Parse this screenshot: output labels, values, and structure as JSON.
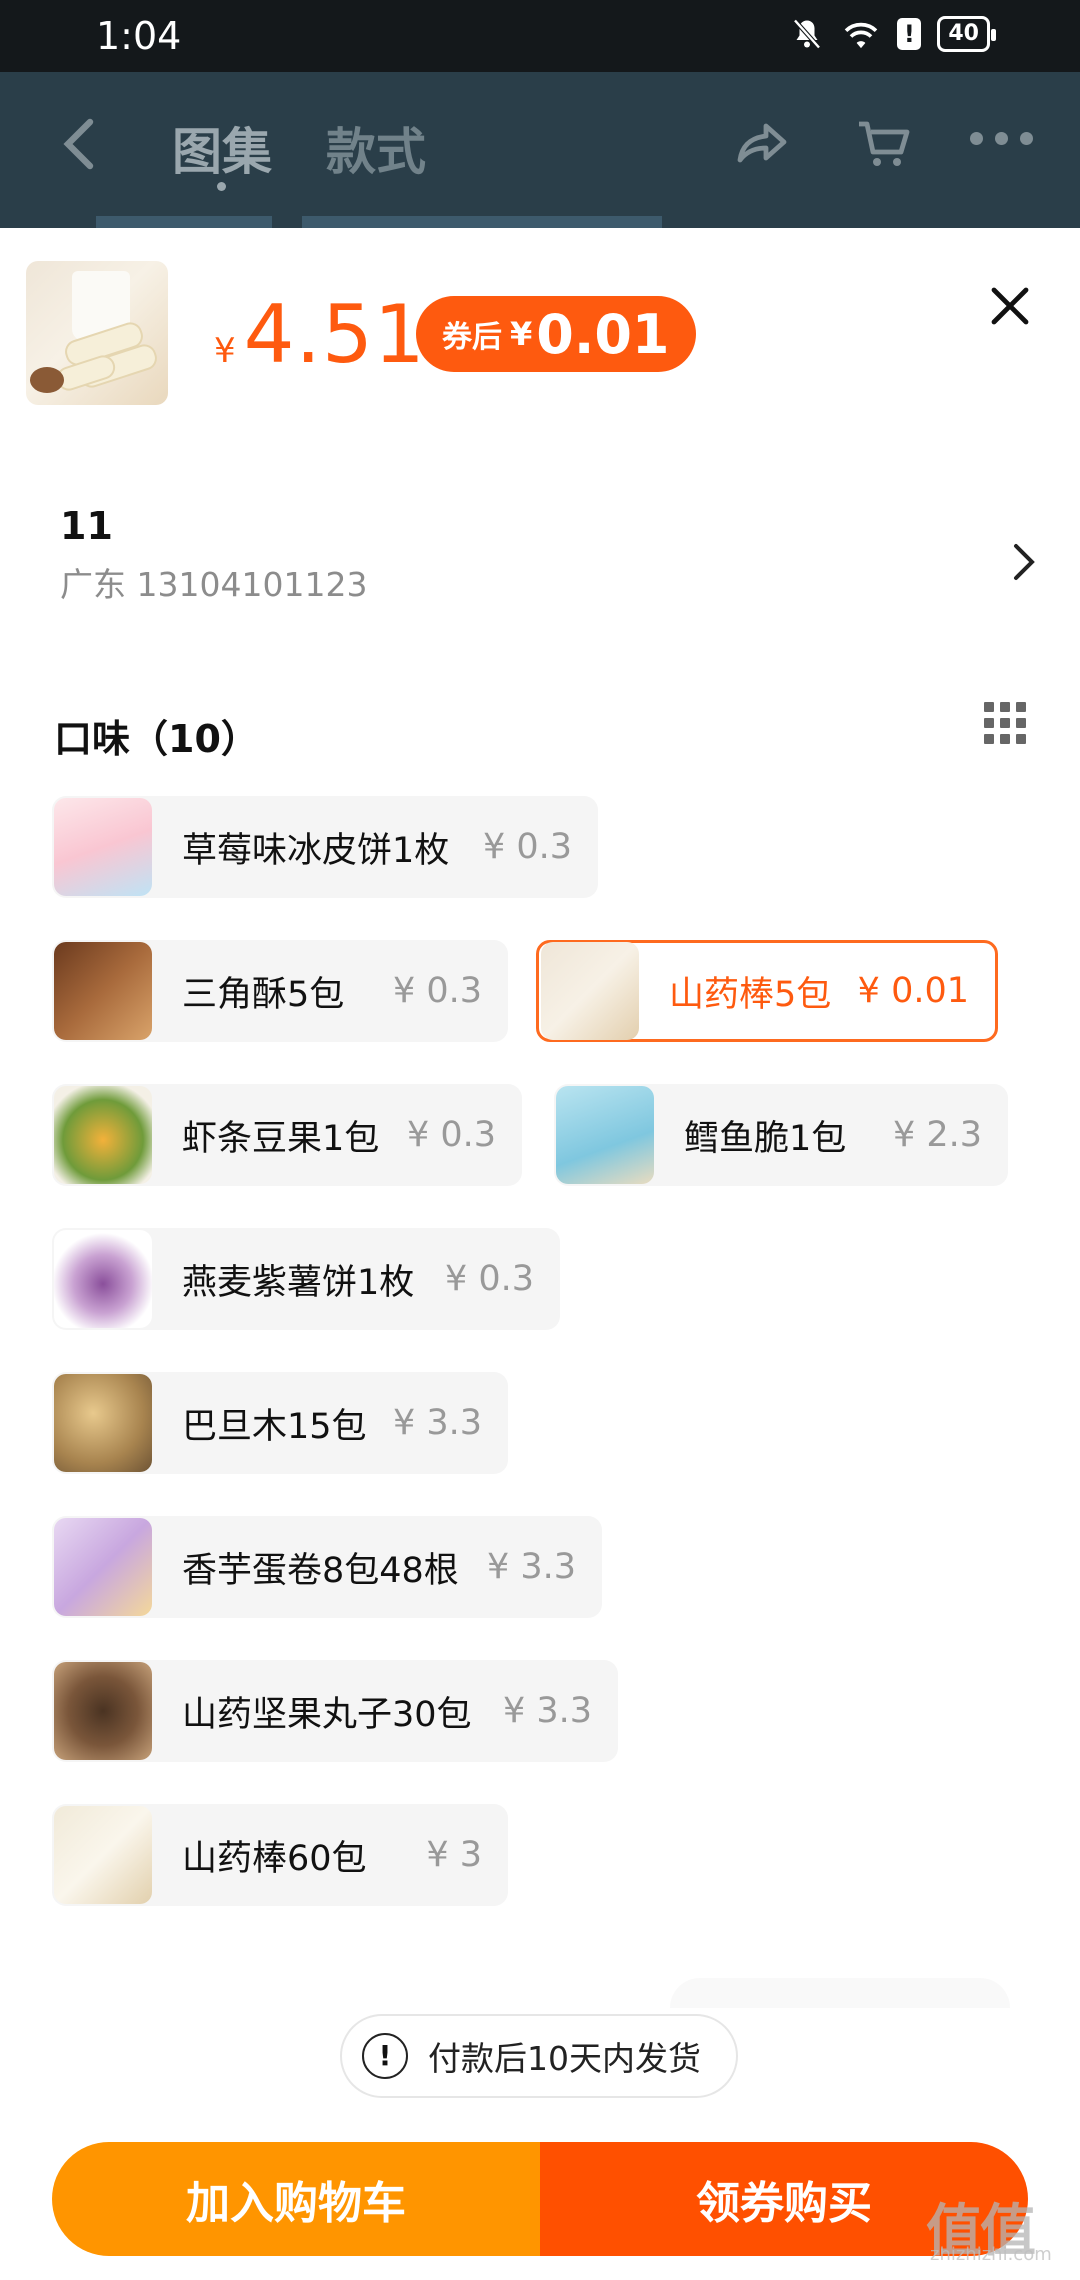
{
  "status_bar": {
    "time": "1:04",
    "battery": "40"
  },
  "header": {
    "tabs": [
      {
        "label": "图集"
      },
      {
        "label": "款式"
      }
    ]
  },
  "product": {
    "price_symbol": "¥",
    "price": "4.51",
    "coupon_label": "券后",
    "coupon_symbol": "¥",
    "coupon_price": "0.01"
  },
  "address": {
    "name": "11",
    "detail": "广东 13104101123"
  },
  "flavor_section": {
    "title": "口味（10）"
  },
  "options": [
    {
      "label": "草莓味冰皮饼1枚",
      "price": "¥ 0.3",
      "selected": false
    },
    {
      "label": "三角酥5包",
      "price": "¥ 0.3",
      "selected": false
    },
    {
      "label": "山药棒5包",
      "price": "¥ 0.01",
      "selected": true
    },
    {
      "label": "虾条豆果1包",
      "price": "¥ 0.3",
      "selected": false
    },
    {
      "label": "鳕鱼脆1包",
      "price": "¥ 2.3",
      "selected": false
    },
    {
      "label": "燕麦紫薯饼1枚",
      "price": "¥ 0.3",
      "selected": false
    },
    {
      "label": "巴旦木15包",
      "price": "¥ 3.3",
      "selected": false
    },
    {
      "label": "香芋蛋卷8包48根",
      "price": "¥ 3.3",
      "selected": false
    },
    {
      "label": "山药坚果丸子30包",
      "price": "¥ 3.3",
      "selected": false
    },
    {
      "label": "山药棒60包",
      "price": "¥ 3",
      "selected": false
    }
  ],
  "notice": {
    "text": "付款后10天内发货"
  },
  "actions": {
    "add_to_cart": "加入购物车",
    "buy": "领券购买"
  },
  "watermark": {
    "text": "值值值",
    "sub": "zhizhizhi.com"
  },
  "colors": {
    "accent": "#fe5a0f",
    "cart_button": "#ff9500",
    "buy_button": "#ff5000"
  }
}
